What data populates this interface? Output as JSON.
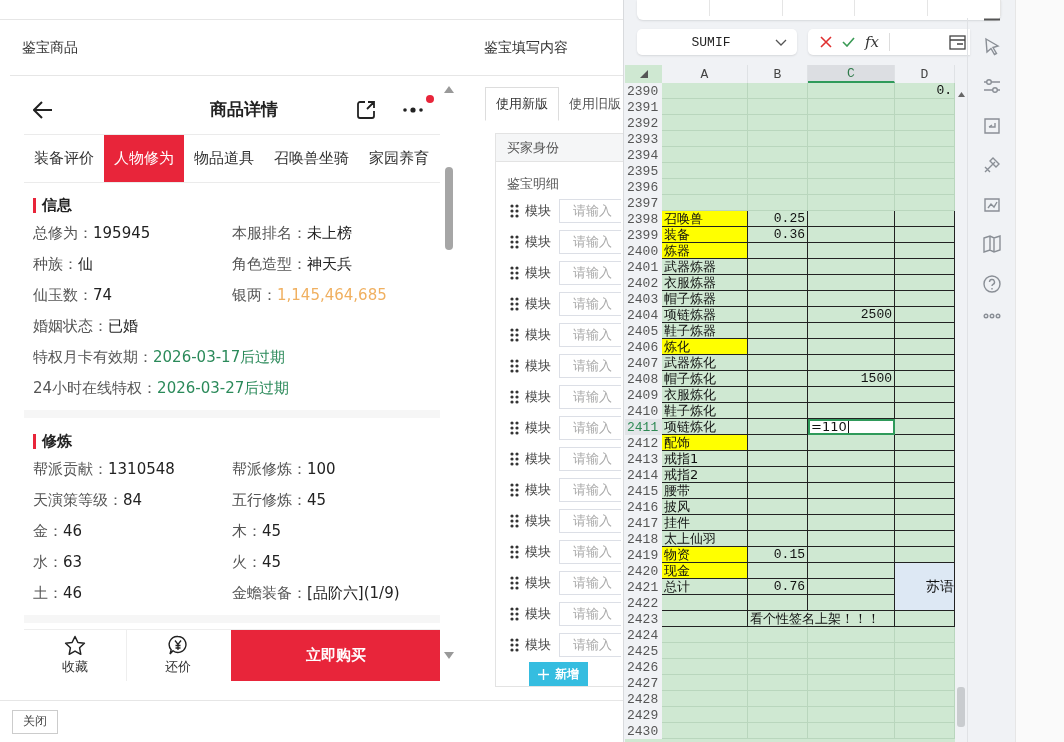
{
  "left_panel": {
    "title": "鉴宝商品",
    "page_title": "商品详情",
    "has_notification": true,
    "tabs": [
      {
        "label": "装备评价",
        "selected": false
      },
      {
        "label": "人物修为",
        "selected": true
      },
      {
        "label": "物品道具",
        "selected": false
      },
      {
        "label": "召唤兽坐骑",
        "selected": false
      },
      {
        "label": "家园养育",
        "selected": false
      }
    ],
    "sections": [
      {
        "title": "信息",
        "rows": [
          [
            {
              "label": "总修为：",
              "value": "195945",
              "color": "#222222"
            },
            {
              "label": "本服排名：",
              "value": "未上榜",
              "color": "#222222"
            }
          ],
          [
            {
              "label": "种族：",
              "value": "仙",
              "color": "#222222"
            },
            {
              "label": "角色造型：",
              "value": "神天兵",
              "color": "#222222"
            }
          ],
          [
            {
              "label": "仙玉数：",
              "value": "74",
              "color": "#222222"
            },
            {
              "label": "银两：",
              "value": "1,145,464,685",
              "color": "#f0b060"
            }
          ],
          [
            {
              "label": "婚姻状态：",
              "value": "已婚",
              "color": "#222222"
            }
          ],
          [
            {
              "label": "特权月卡有效期：",
              "value": "2026-03-17后过期",
              "color": "#2b8a5a"
            }
          ],
          [
            {
              "label": "24小时在线特权：",
              "value": "2026-03-27后过期",
              "color": "#2b8a5a"
            }
          ]
        ]
      },
      {
        "title": "修炼",
        "rows": [
          [
            {
              "label": "帮派贡献：",
              "value": "1310548",
              "color": "#222222"
            },
            {
              "label": "帮派修炼：",
              "value": "100",
              "color": "#222222"
            }
          ],
          [
            {
              "label": "天演策等级：",
              "value": "84",
              "color": "#222222"
            },
            {
              "label": "五行修炼：",
              "value": "45",
              "color": "#222222"
            }
          ],
          [
            {
              "label": "金：",
              "value": "46",
              "color": "#222222"
            },
            {
              "label": "木：",
              "value": "45",
              "color": "#222222"
            }
          ],
          [
            {
              "label": "水：",
              "value": "63",
              "color": "#222222"
            },
            {
              "label": "火：",
              "value": "45",
              "color": "#222222"
            }
          ],
          [
            {
              "label": "土：",
              "value": "46",
              "color": "#222222"
            },
            {
              "label": "金蟾装备：",
              "value": "[品阶六](1/9)",
              "color": "#222222"
            }
          ]
        ]
      }
    ],
    "actions": {
      "favorite": "收藏",
      "bargain": "还价",
      "buy": "立即购买"
    }
  },
  "editor_panel": {
    "title": "鉴宝填写内容",
    "tabs": [
      {
        "label": "使用新版",
        "selected": true
      },
      {
        "label": "使用旧版",
        "selected": false
      }
    ],
    "section_header": "买家身份",
    "detail_label": "鉴宝明细",
    "modules": [
      {
        "label": "模块",
        "placeholder": "请输入"
      },
      {
        "label": "模块",
        "placeholder": "请输入"
      },
      {
        "label": "模块",
        "placeholder": "请输入"
      },
      {
        "label": "模块",
        "placeholder": "请输入"
      },
      {
        "label": "模块",
        "placeholder": "请输入"
      },
      {
        "label": "模块",
        "placeholder": "请输入"
      },
      {
        "label": "模块",
        "placeholder": "请输入"
      },
      {
        "label": "模块",
        "placeholder": "请输入"
      },
      {
        "label": "模块",
        "placeholder": "请输入"
      },
      {
        "label": "模块",
        "placeholder": "请输入"
      },
      {
        "label": "模块",
        "placeholder": "请输入"
      },
      {
        "label": "模块",
        "placeholder": "请输入"
      },
      {
        "label": "模块",
        "placeholder": "请输入"
      },
      {
        "label": "模块",
        "placeholder": "请输入"
      },
      {
        "label": "模块",
        "placeholder": "请输入"
      }
    ],
    "add_button": "新增"
  },
  "footer": {
    "close_button": "关闭"
  },
  "spreadsheet": {
    "name_box": "SUMIF",
    "formula_symbol": "fx",
    "columns": [
      {
        "label": "A",
        "selected": false
      },
      {
        "label": "B",
        "selected": false
      },
      {
        "label": "C",
        "selected": true
      },
      {
        "label": "D",
        "selected": false
      }
    ],
    "rows": [
      {
        "number": "2390",
        "selected": false,
        "bordered": false,
        "cells": {
          "d": {
            "text": "0.",
            "kind": "number",
            "highlight": false
          }
        }
      },
      {
        "number": "2391",
        "selected": false,
        "bordered": false,
        "cells": {}
      },
      {
        "number": "2392",
        "selected": false,
        "bordered": false,
        "cells": {}
      },
      {
        "number": "2393",
        "selected": false,
        "bordered": false,
        "cells": {}
      },
      {
        "number": "2394",
        "selected": false,
        "bordered": false,
        "cells": {}
      },
      {
        "number": "2395",
        "selected": false,
        "bordered": false,
        "cells": {}
      },
      {
        "number": "2396",
        "selected": false,
        "bordered": false,
        "cells": {}
      },
      {
        "number": "2397",
        "selected": false,
        "bordered": false,
        "cells": {}
      },
      {
        "number": "2398",
        "selected": false,
        "bordered": true,
        "cells": {
          "a": {
            "text": "召唤兽",
            "kind": "text",
            "highlight": true
          },
          "b": {
            "text": "0.25",
            "kind": "number",
            "highlight": false
          }
        }
      },
      {
        "number": "2399",
        "selected": false,
        "bordered": true,
        "cells": {
          "a": {
            "text": "装备",
            "kind": "text",
            "highlight": true
          },
          "b": {
            "text": "0.36",
            "kind": "number",
            "highlight": false
          }
        }
      },
      {
        "number": "2400",
        "selected": false,
        "bordered": true,
        "cells": {
          "a": {
            "text": "炼器",
            "kind": "text",
            "highlight": true
          }
        }
      },
      {
        "number": "2401",
        "selected": false,
        "bordered": true,
        "cells": {
          "a": {
            "text": "武器炼器",
            "kind": "text",
            "highlight": false
          }
        }
      },
      {
        "number": "2402",
        "selected": false,
        "bordered": true,
        "cells": {
          "a": {
            "text": "衣服炼器",
            "kind": "text",
            "highlight": false
          }
        }
      },
      {
        "number": "2403",
        "selected": false,
        "bordered": true,
        "cells": {
          "a": {
            "text": "帽子炼器",
            "kind": "text",
            "highlight": false
          }
        }
      },
      {
        "number": "2404",
        "selected": false,
        "bordered": true,
        "cells": {
          "a": {
            "text": "项链炼器",
            "kind": "text",
            "highlight": false
          },
          "c": {
            "text": "2500",
            "kind": "number",
            "highlight": false
          }
        }
      },
      {
        "number": "2405",
        "selected": false,
        "bordered": true,
        "cells": {
          "a": {
            "text": "鞋子炼器",
            "kind": "text",
            "highlight": false
          }
        }
      },
      {
        "number": "2406",
        "selected": false,
        "bordered": true,
        "cells": {
          "a": {
            "text": "炼化",
            "kind": "text",
            "highlight": true
          }
        }
      },
      {
        "number": "2407",
        "selected": false,
        "bordered": true,
        "cells": {
          "a": {
            "text": "武器炼化",
            "kind": "text",
            "highlight": false
          }
        }
      },
      {
        "number": "2408",
        "selected": false,
        "bordered": true,
        "cells": {
          "a": {
            "text": "帽子炼化",
            "kind": "text",
            "highlight": false
          },
          "c": {
            "text": "1500",
            "kind": "number",
            "highlight": false
          }
        }
      },
      {
        "number": "2409",
        "selected": false,
        "bordered": true,
        "cells": {
          "a": {
            "text": "衣服炼化",
            "kind": "text",
            "highlight": false
          }
        }
      },
      {
        "number": "2410",
        "selected": false,
        "bordered": true,
        "cells": {
          "a": {
            "text": "鞋子炼化",
            "kind": "text",
            "highlight": false
          }
        }
      },
      {
        "number": "2411",
        "selected": true,
        "bordered": true,
        "cells": {
          "a": {
            "text": "项链炼化",
            "kind": "text",
            "highlight": false
          },
          "c": {
            "text": "=110",
            "kind": "formula",
            "highlight": false
          }
        }
      },
      {
        "number": "2412",
        "selected": false,
        "bordered": true,
        "cells": {
          "a": {
            "text": "配饰",
            "kind": "text",
            "highlight": true
          }
        }
      },
      {
        "number": "2413",
        "selected": false,
        "bordered": true,
        "cells": {
          "a": {
            "text": "戒指1",
            "kind": "text",
            "highlight": false
          }
        }
      },
      {
        "number": "2414",
        "selected": false,
        "bordered": true,
        "cells": {
          "a": {
            "text": "戒指2",
            "kind": "text",
            "highlight": false
          }
        }
      },
      {
        "number": "2415",
        "selected": false,
        "bordered": true,
        "cells": {
          "a": {
            "text": "腰带",
            "kind": "text",
            "highlight": false
          }
        }
      },
      {
        "number": "2416",
        "selected": false,
        "bordered": true,
        "cells": {
          "a": {
            "text": "披风",
            "kind": "text",
            "highlight": false
          }
        }
      },
      {
        "number": "2417",
        "selected": false,
        "bordered": true,
        "cells": {
          "a": {
            "text": "挂件",
            "kind": "text",
            "highlight": false
          }
        }
      },
      {
        "number": "2418",
        "selected": false,
        "bordered": true,
        "cells": {
          "a": {
            "text": "太上仙羽",
            "kind": "text",
            "highlight": false
          }
        }
      },
      {
        "number": "2419",
        "selected": false,
        "bordered": true,
        "cells": {
          "a": {
            "text": "物资",
            "kind": "text",
            "highlight": true
          },
          "b": {
            "text": "0.15",
            "kind": "number",
            "highlight": false
          }
        }
      },
      {
        "number": "2420",
        "selected": false,
        "bordered": true,
        "cells": {
          "a": {
            "text": "现金",
            "kind": "text",
            "highlight": true
          },
          "d": {
            "text": "苏语",
            "kind": "note",
            "highlight": false
          }
        }
      },
      {
        "number": "2421",
        "selected": false,
        "bordered": true,
        "cells": {
          "a": {
            "text": "总计",
            "kind": "text",
            "highlight": false
          },
          "b": {
            "text": "0.76",
            "kind": "number",
            "highlight": false
          }
        }
      },
      {
        "number": "2422",
        "selected": false,
        "bordered": true,
        "cells": {}
      },
      {
        "number": "2423",
        "selected": false,
        "bordered": true,
        "cells": {
          "b": {
            "text": "看个性签名上架！！！",
            "kind": "banner",
            "highlight": false
          }
        }
      },
      {
        "number": "2424",
        "selected": false,
        "bordered": false,
        "cells": {}
      },
      {
        "number": "2425",
        "selected": false,
        "bordered": false,
        "cells": {}
      },
      {
        "number": "2426",
        "selected": false,
        "bordered": false,
        "cells": {}
      },
      {
        "number": "2427",
        "selected": false,
        "bordered": false,
        "cells": {}
      },
      {
        "number": "2428",
        "selected": false,
        "bordered": false,
        "cells": {}
      },
      {
        "number": "2429",
        "selected": false,
        "bordered": false,
        "cells": {}
      },
      {
        "number": "2430",
        "selected": false,
        "bordered": false,
        "cells": {}
      }
    ]
  }
}
